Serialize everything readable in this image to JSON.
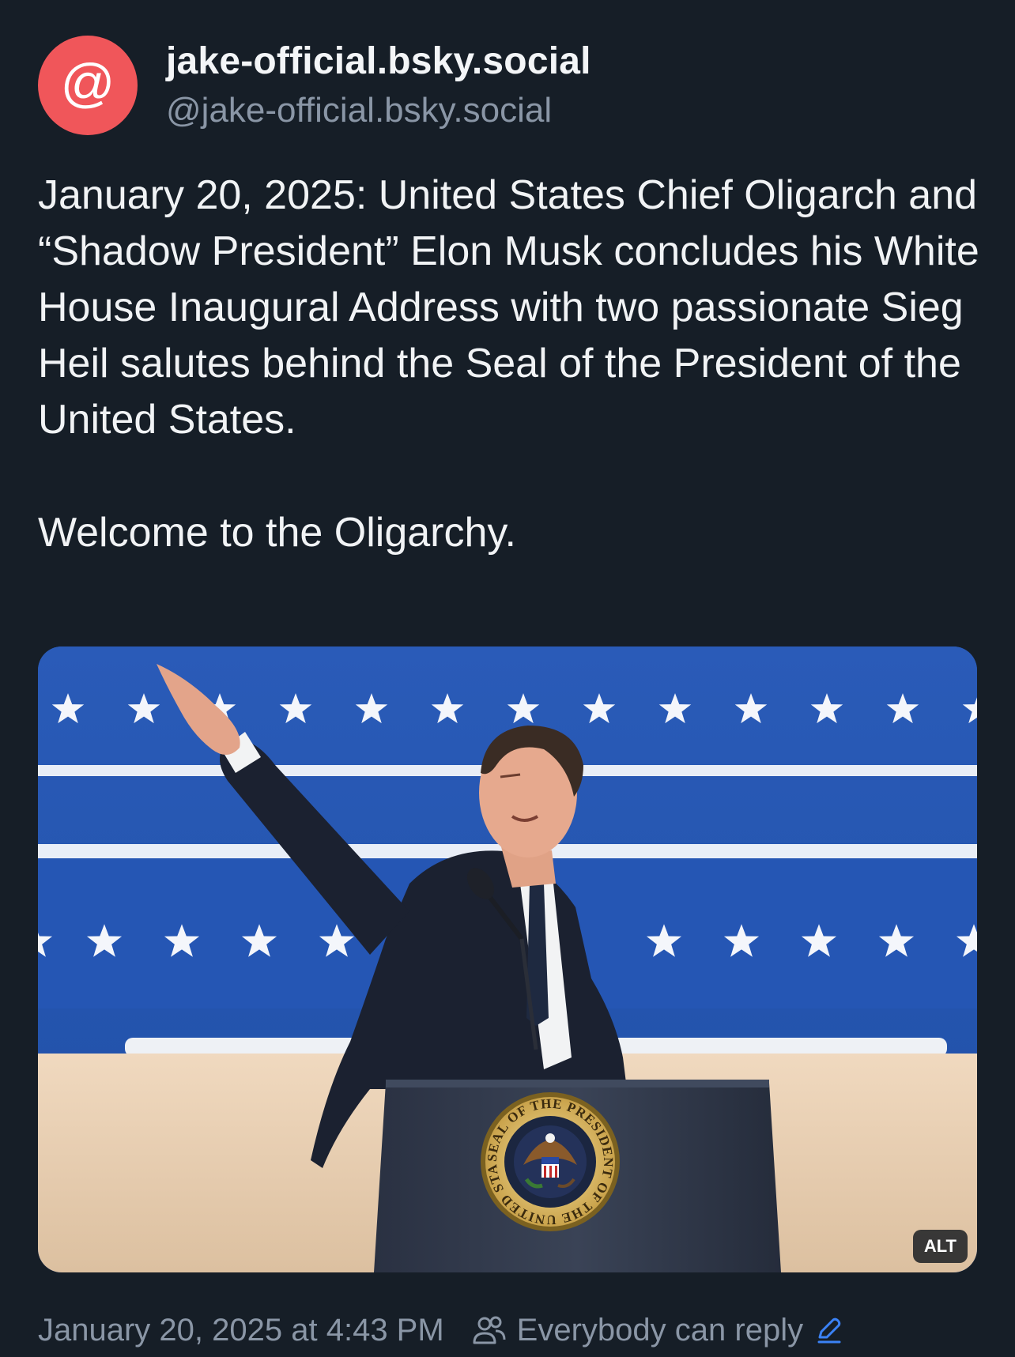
{
  "author": {
    "avatar_glyph": "@",
    "avatar_color": "#f0565a",
    "display_name": "jake-official.bsky.social",
    "handle": "@jake-official.bsky.social"
  },
  "post": {
    "paragraph_1": "January 20, 2025: United States Chief Oligarch and “Shadow President” Elon Musk concludes his White House Inaugural Address with two passionate Sieg Heil salutes behind the Seal of the President of the United States.",
    "paragraph_2": "Welcome to the Oligarchy."
  },
  "image": {
    "alt_badge": "ALT",
    "seal_text": "SEAL OF THE PRESIDENT OF THE UNITED STATES"
  },
  "footer": {
    "timestamp": "January 20, 2025 at 4:43 PM",
    "reply_setting": "Everybody can reply",
    "accent_color": "#3b82f6"
  }
}
